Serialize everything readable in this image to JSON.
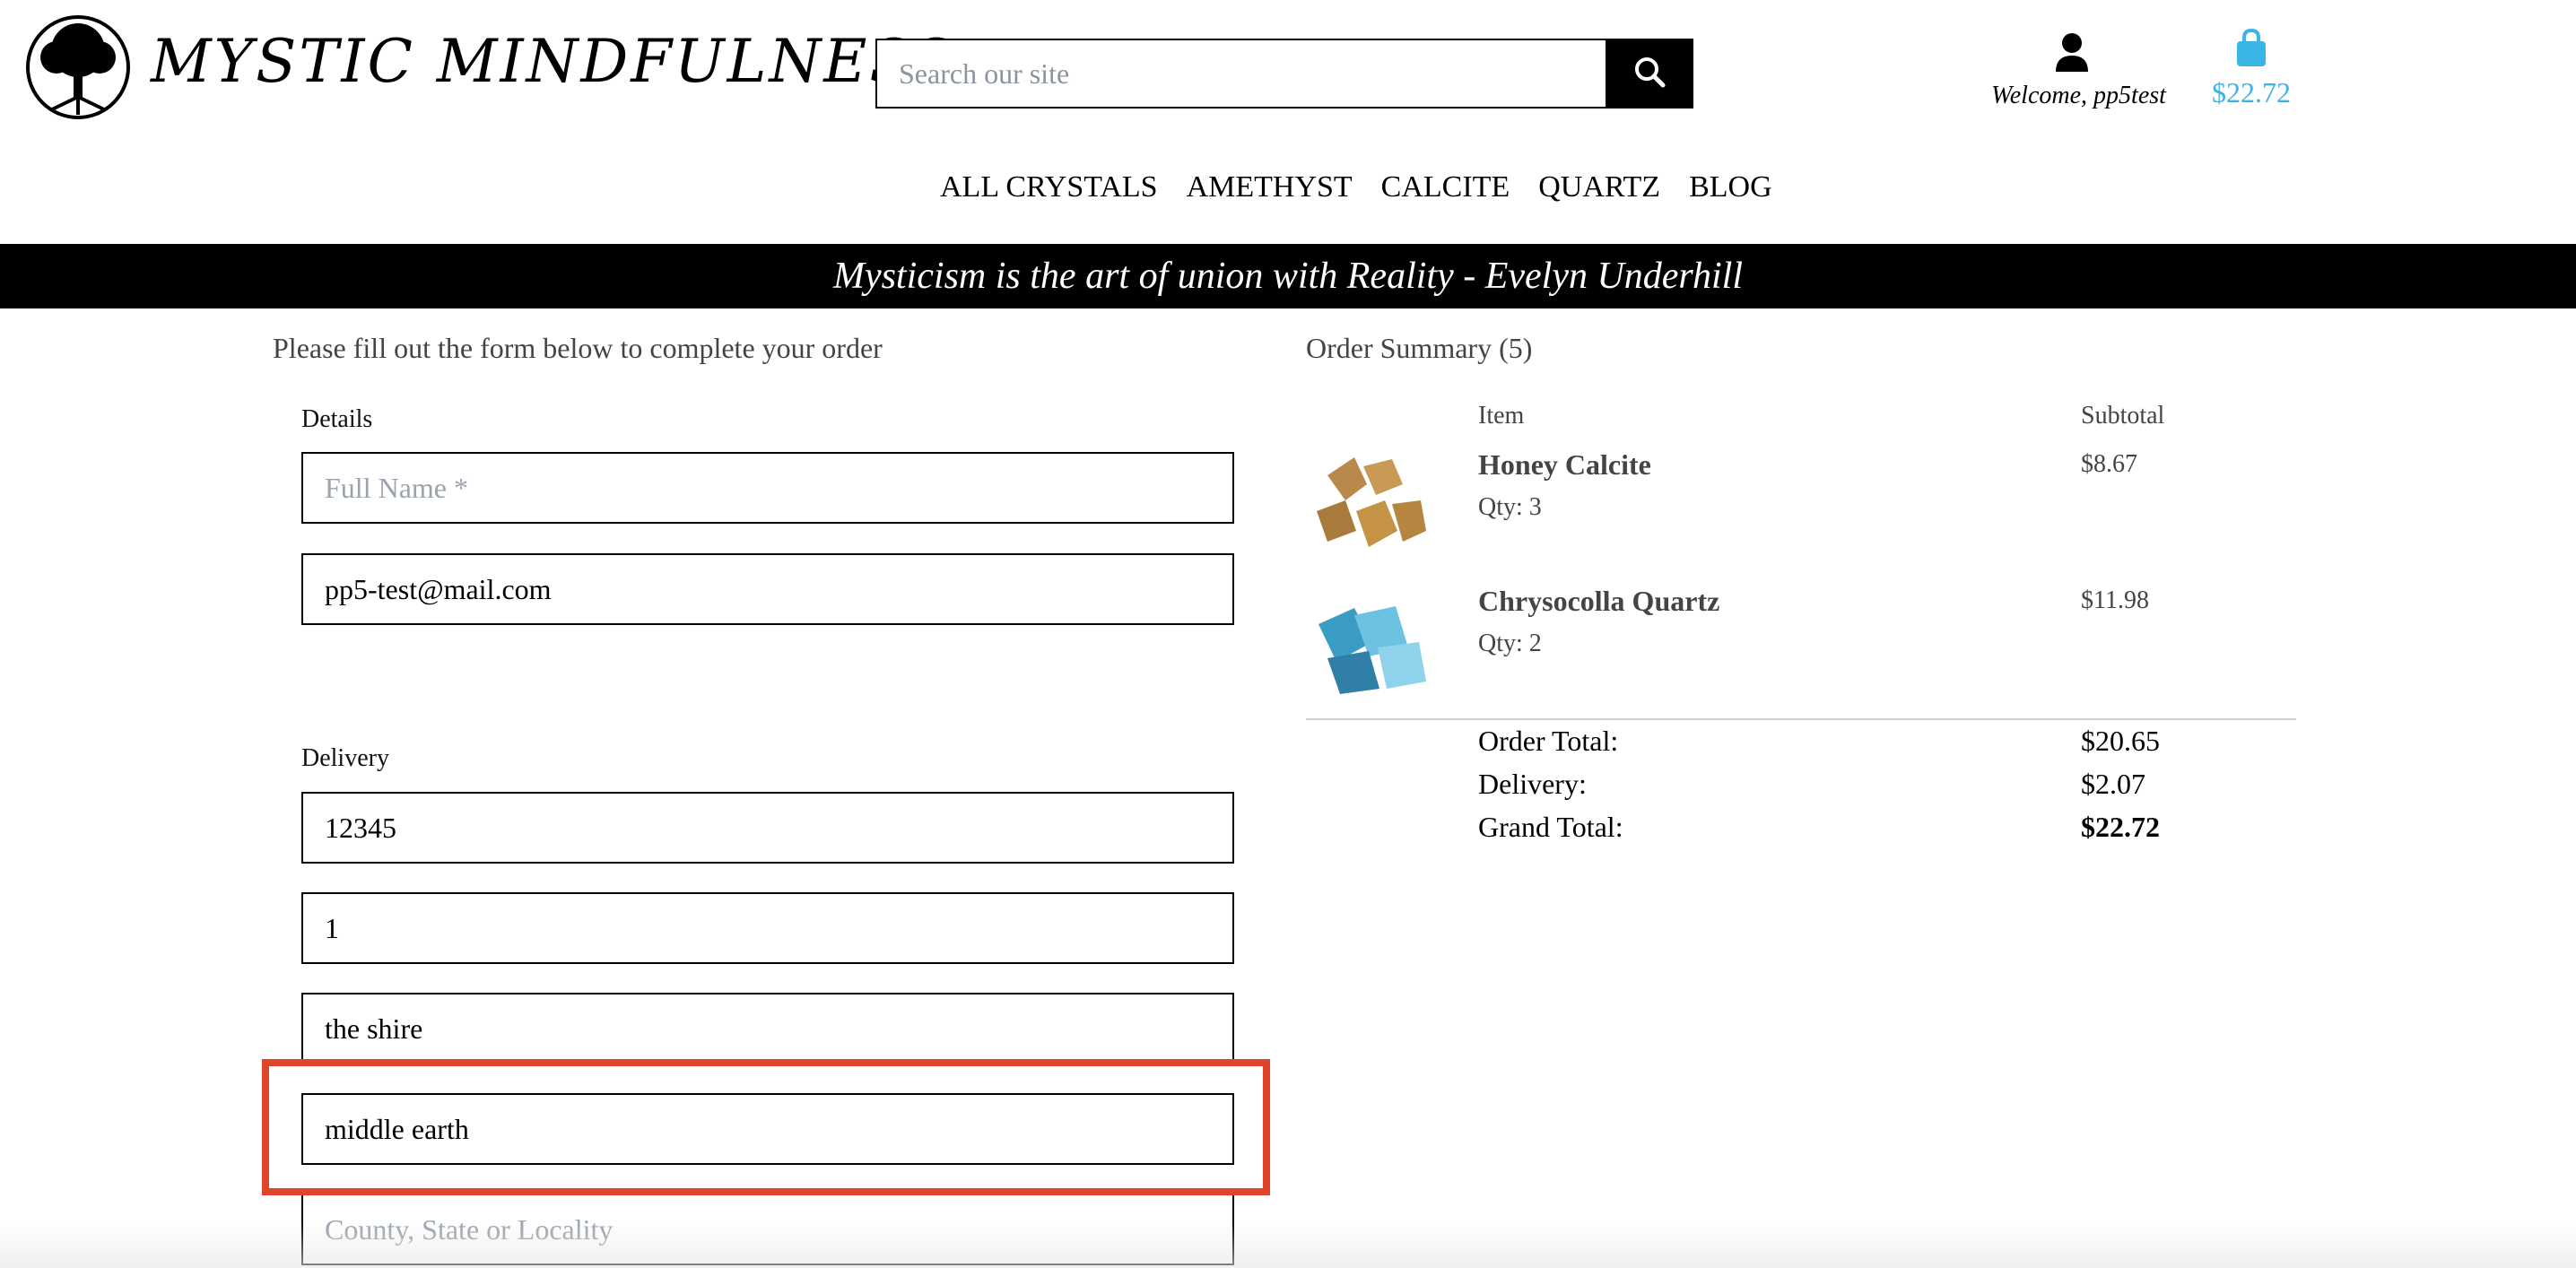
{
  "header": {
    "brand": "MYSTIC MINDFULNESS",
    "search_placeholder": "Search our site",
    "account_label": "Welcome, pp5test",
    "cart_total": "$22.72"
  },
  "nav": {
    "items": [
      "ALL CRYSTALS",
      "AMETHYST",
      "CALCITE",
      "QUARTZ",
      "BLOG"
    ]
  },
  "banner": {
    "quote": "Mysticism is the art of union with Reality - Evelyn Underhill"
  },
  "form": {
    "intro": "Please fill out the form below to complete your order",
    "details_label": "Details",
    "full_name_placeholder": "Full Name *",
    "email_value": "pp5-test@mail.com",
    "delivery_label": "Delivery",
    "field_postcode": "12345",
    "field_address1": "1",
    "field_address2": "the shire",
    "field_town": "middle earth",
    "county_placeholder": "County, State or Locality"
  },
  "summary": {
    "title": "Order Summary (5)",
    "col_item": "Item",
    "col_subtotal": "Subtotal",
    "items": [
      {
        "name": "Honey Calcite",
        "qty": "Qty: 3",
        "subtotal": "$8.67"
      },
      {
        "name": "Chrysocolla Quartz",
        "qty": "Qty: 2",
        "subtotal": "$11.98"
      }
    ],
    "order_total_label": "Order Total:",
    "order_total": "$20.65",
    "delivery_label": "Delivery:",
    "delivery": "$2.07",
    "grand_total_label": "Grand Total:",
    "grand_total": "$22.72"
  },
  "colors": {
    "accent": "#3bb4e6",
    "highlight": "#e0432c",
    "banner_bg": "#000000"
  }
}
